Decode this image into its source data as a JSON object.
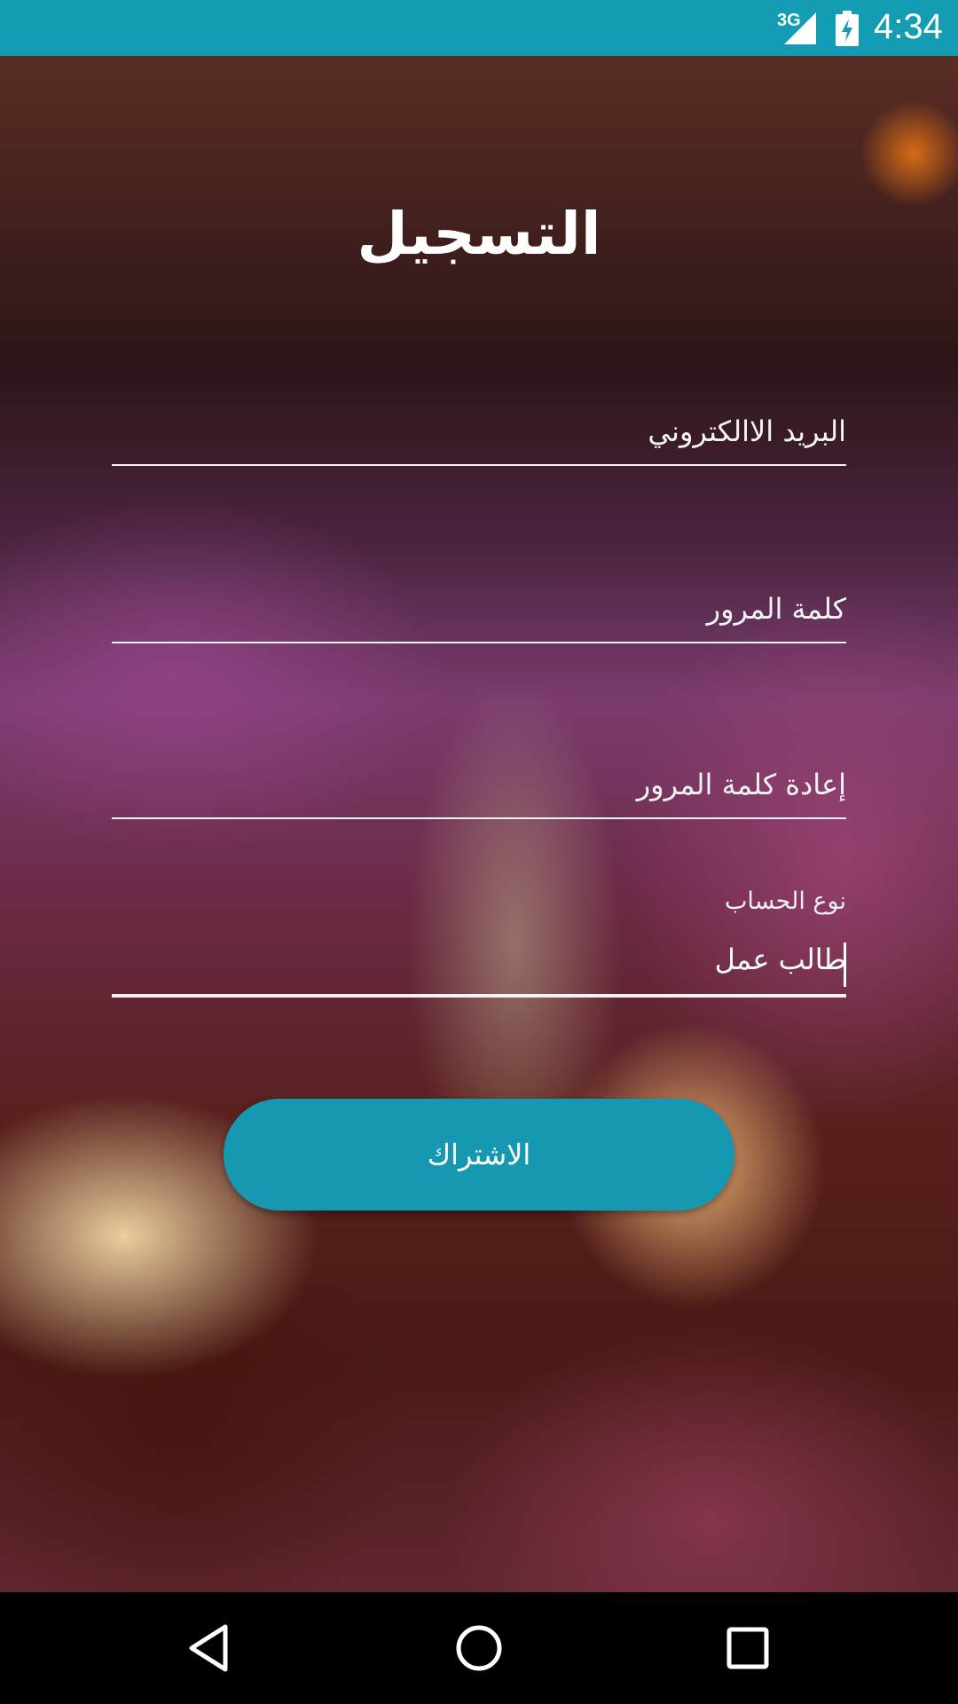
{
  "status_bar": {
    "network": "3G",
    "time": "4:34",
    "background_color": "#159cb5"
  },
  "icons": {
    "signal": "signal-icon",
    "battery": "battery-charging-icon",
    "back": "back-triangle-icon",
    "home": "home-circle-icon",
    "recent": "recent-apps-square-icon"
  },
  "title": "التسجيل",
  "form": {
    "email_placeholder": "البريد الاالكتروني",
    "password_placeholder": "كلمة المرور",
    "confirm_password_placeholder": "إعادة كلمة المرور",
    "account_type_label": "نوع الحساب",
    "account_type_value": "طالب عمل"
  },
  "signup_button": {
    "label": "الاشتراك",
    "color": "#1698b2"
  }
}
